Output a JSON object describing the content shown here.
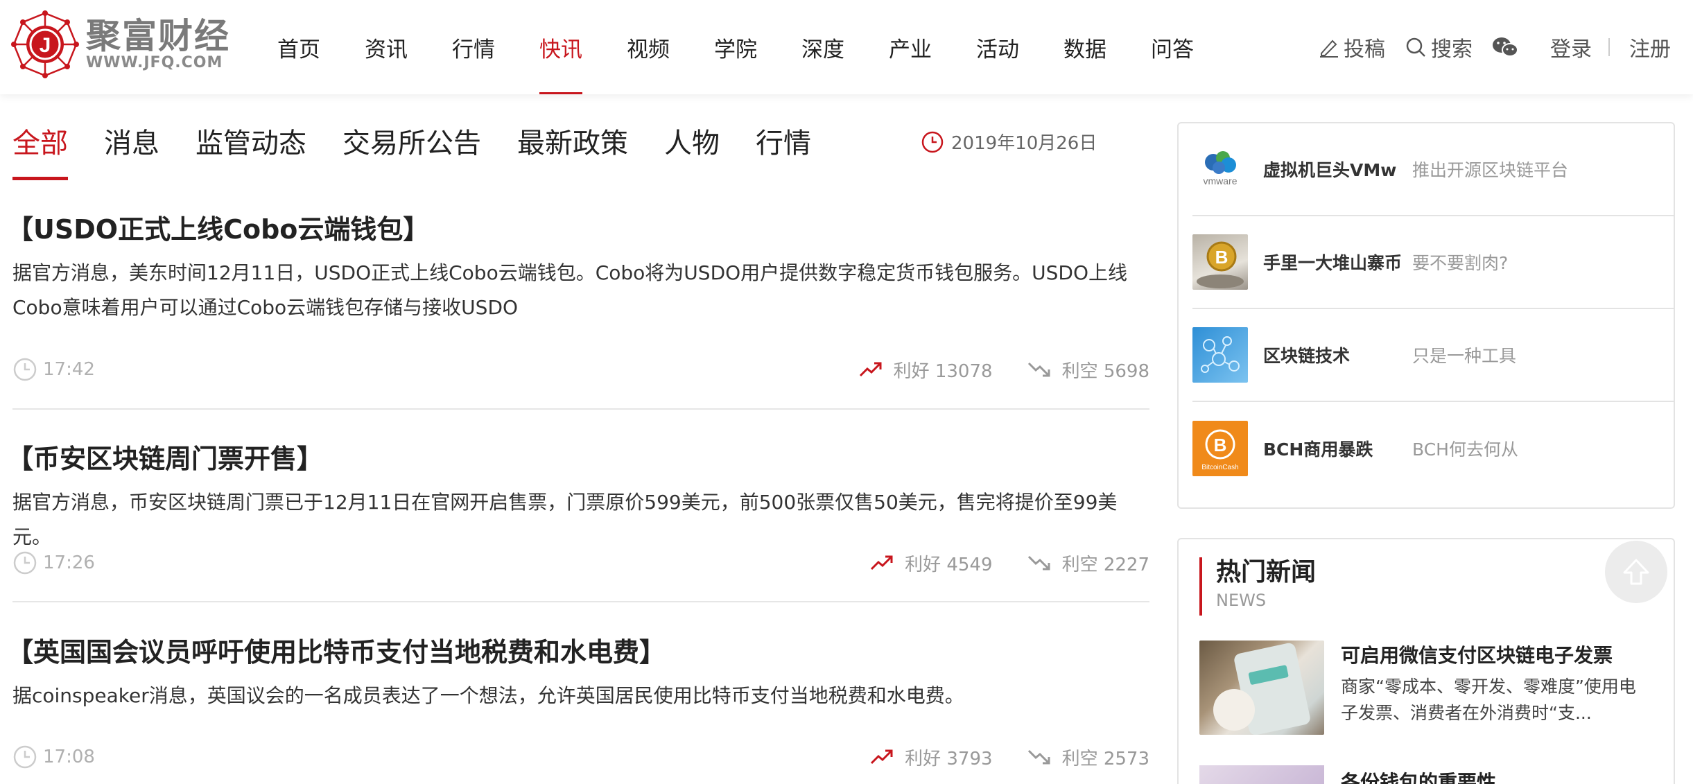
{
  "brand": {
    "name": "聚富财经",
    "url": "WWW.JFQ.COM",
    "accent_color": "#c8161d"
  },
  "nav": {
    "items": [
      "首页",
      "资讯",
      "行情",
      "快讯",
      "视频",
      "学院",
      "深度",
      "产业",
      "活动",
      "数据",
      "问答"
    ],
    "active": "快讯"
  },
  "header_actions": {
    "submit": "投稿",
    "search": "搜索",
    "wechat_icon": "wechat-icon",
    "login": "登录",
    "register": "注册"
  },
  "tabs": {
    "items": [
      "全部",
      "消息",
      "监管动态",
      "交易所公告",
      "最新政策",
      "人物",
      "行情"
    ],
    "active": "全部"
  },
  "date": "2019年10月26日",
  "news": [
    {
      "title": "【USDO正式上线Cobo云端钱包】",
      "body": "据官方消息，美东时间12月11日，USDO正式上线Cobo云端钱包。Cobo将为USDO用户提供数字稳定货币钱包服务。USDO上线Cobo意味着用户可以通过Cobo云端钱包存储与接收USDO",
      "time": "17:42",
      "bull": "利好 13078",
      "bear": "利空 5698"
    },
    {
      "title": "【币安区块链周门票开售】",
      "body": "据官方消息，币安区块链周门票已于12月11日在官网开启售票，门票原价599美元，前500张票仅售50美元，售完将提价至99美元。",
      "time": "17:26",
      "bull": "利好 4549",
      "bear": "利空 2227"
    },
    {
      "title": "【英国国会议员呼吁使用比特币支付当地税费和水电费】",
      "body": "据coinspeaker消息，英国议会的一名成员表达了一个想法，允许英国居民使用比特币支付当地税费和水电费。",
      "time": "17:08",
      "bull": "利好 3793",
      "bear": "利空 2573"
    }
  ],
  "sidebar": {
    "items": [
      {
        "title": "虚拟机巨头VMw",
        "sub": "推出开源区块链平台",
        "thumb_label": "vmware"
      },
      {
        "title": "手里一大堆山寨币",
        "sub": "要不要割肉?",
        "thumb_label": "B"
      },
      {
        "title": "区块链技术",
        "sub": "只是一种工具",
        "thumb_label": ""
      },
      {
        "title": "BCH商用暴跌",
        "sub": "BCH何去何从",
        "thumb_label": "BitcoinCash"
      }
    ]
  },
  "hot_news": {
    "title": "热门新闻",
    "subtitle": "NEWS",
    "items": [
      {
        "title": "可启用微信支付区块链电子发票",
        "desc_line1": "商家“零成本、零开发、零难度”使用电",
        "desc_line2": "子发票、消费者在外消费时“支..."
      },
      {
        "title": "各份钱包的重要性"
      }
    ]
  }
}
